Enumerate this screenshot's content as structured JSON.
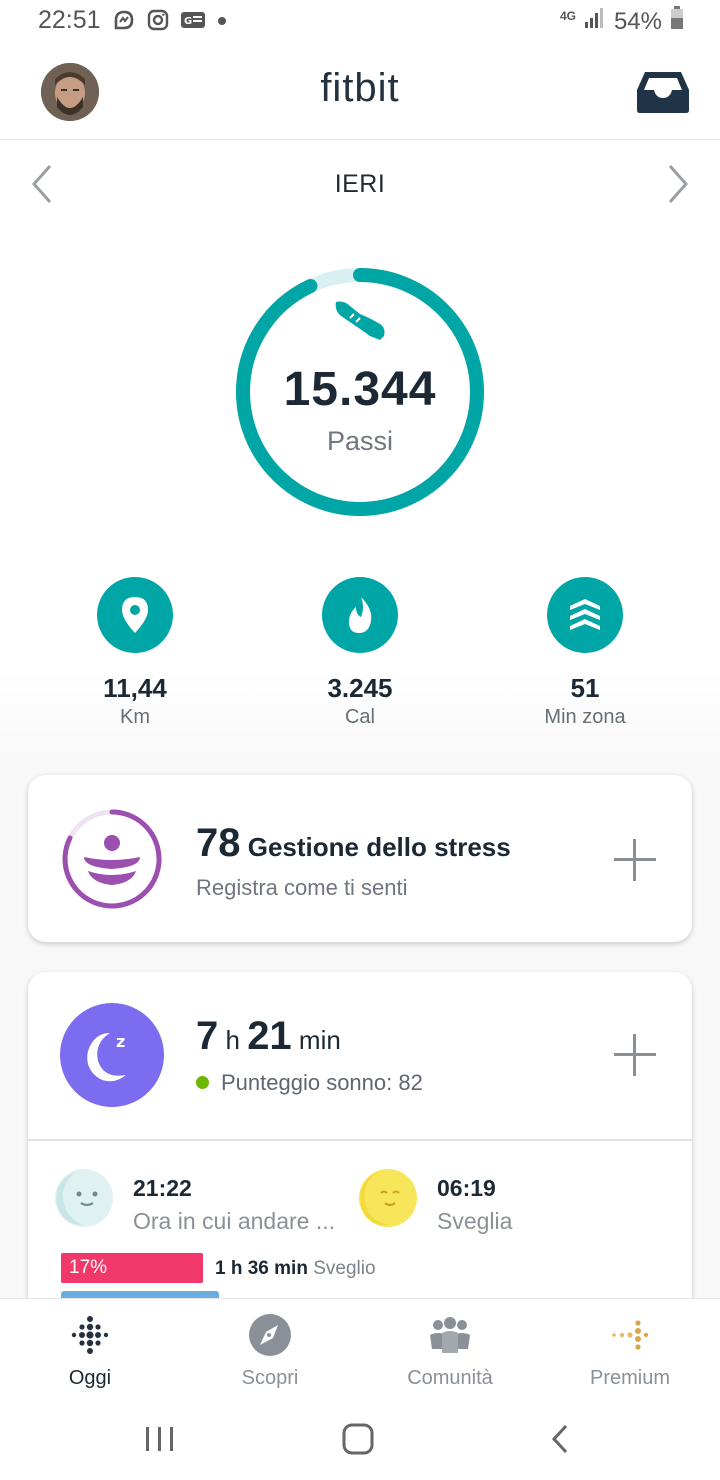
{
  "status_bar": {
    "time": "22:51",
    "network": "4G",
    "battery": "54%"
  },
  "header": {
    "logo": "fitbit"
  },
  "day_nav": {
    "title": "IERI"
  },
  "steps": {
    "value": "15.344",
    "label": "Passi",
    "progress": 0.93
  },
  "stats": [
    {
      "icon": "location-pin-icon",
      "value": "11,44",
      "unit": "Km"
    },
    {
      "icon": "flame-icon",
      "value": "3.245",
      "unit": "Cal"
    },
    {
      "icon": "zone-chevrons-icon",
      "value": "51",
      "unit": "Min zona"
    }
  ],
  "stress": {
    "score": "78",
    "title": "Gestione dello stress",
    "subtitle": "Registra come ti senti"
  },
  "sleep": {
    "hours": "7",
    "hours_unit": "h",
    "minutes": "21",
    "minutes_unit": "min",
    "score_text": "Punteggio sonno: 82",
    "bedtime": {
      "time": "21:22",
      "label": "Ora in cui andare ..."
    },
    "wake": {
      "time": "06:19",
      "label": "Sveglia"
    },
    "stage": {
      "percent": "17%",
      "duration": "1 h 36 min",
      "name": "Sveglio"
    }
  },
  "bottom_nav": [
    {
      "label": "Oggi",
      "active": true
    },
    {
      "label": "Scopri",
      "active": false
    },
    {
      "label": "Comunità",
      "active": false
    },
    {
      "label": "Premium",
      "active": false
    }
  ],
  "colors": {
    "teal": "#00a6a6",
    "stress_purple": "#9b4fae",
    "sleep_purple": "#7b6cf0",
    "awake_pink": "#f0386b",
    "score_green": "#6cb800"
  }
}
